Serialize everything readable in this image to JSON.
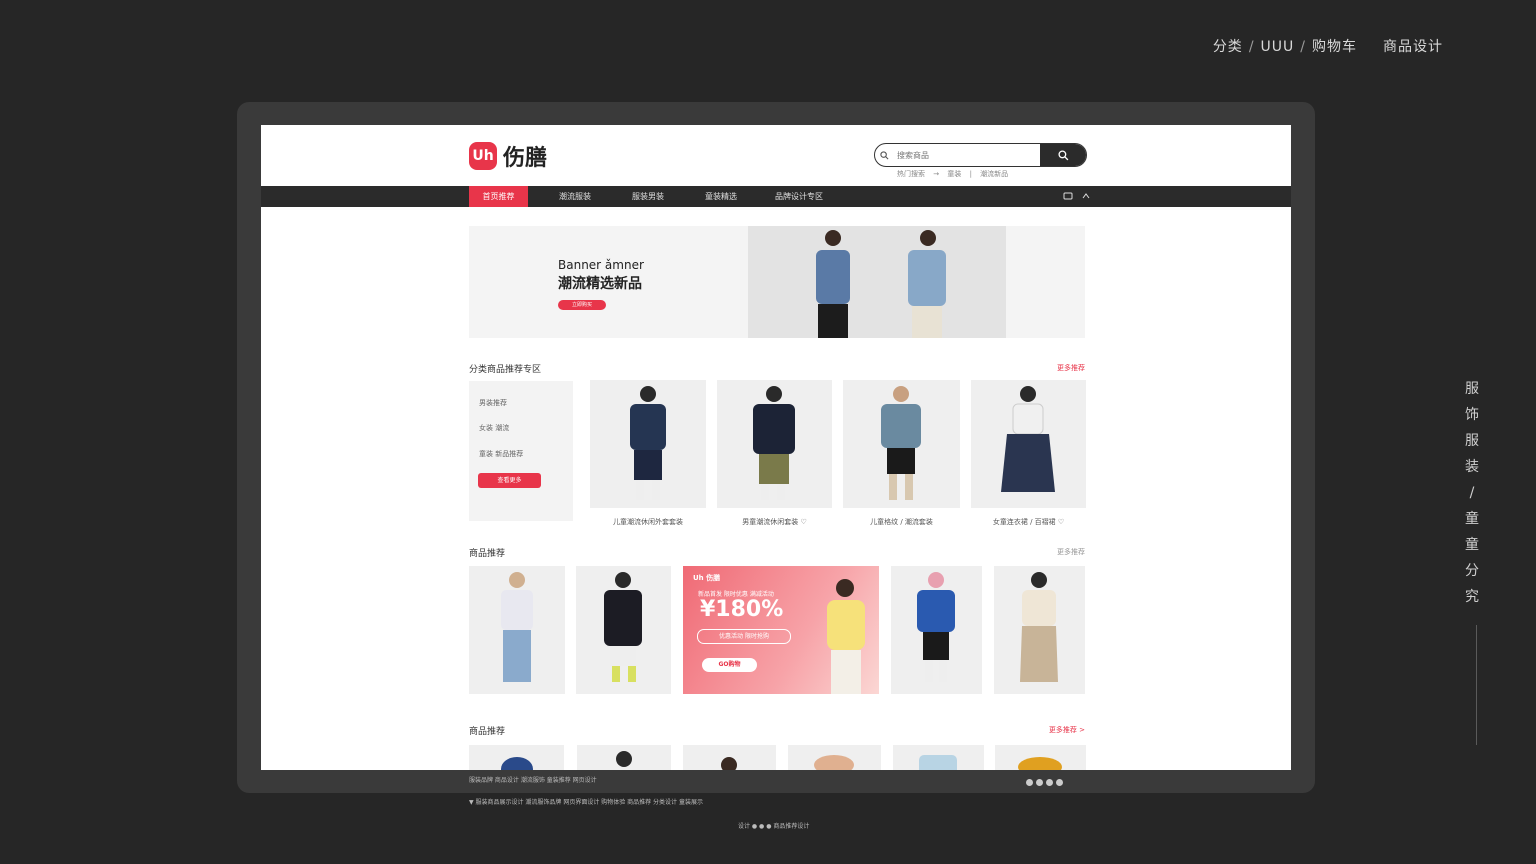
{
  "breadcrumb": {
    "items": [
      "分类",
      "UUU",
      "购物车"
    ],
    "separator": "/",
    "current": "商品设计"
  },
  "side_label": {
    "chars": [
      "服",
      "饰",
      "服",
      "装",
      "/",
      "童",
      "童",
      "分",
      "究"
    ]
  },
  "brand": {
    "logo_mark": "Uh",
    "name": "伤膳",
    "accent": "#e8354a"
  },
  "search": {
    "placeholder": "搜索商品",
    "hot": [
      "热门搜索",
      "→",
      "童装",
      "|",
      "潮流新品"
    ]
  },
  "nav": {
    "items": [
      {
        "label": "首页推荐",
        "active": true
      },
      {
        "label": "潮流服装",
        "active": false
      },
      {
        "label": "服装男装",
        "active": false
      },
      {
        "label": "童装精选",
        "active": false
      },
      {
        "label": "品牌设计专区",
        "active": false
      }
    ],
    "icons": [
      "cart-icon",
      "user-icon"
    ]
  },
  "banner": {
    "title_en": "Banner ǎmner",
    "title_cn": "潮流精选新品",
    "button": "立即购买"
  },
  "section1": {
    "title": "分类商品推荐专区",
    "more": "更多推荐",
    "categories": [
      "男装推荐",
      "女装 潮流",
      "童装 新品推荐"
    ],
    "cat_button": "查看更多",
    "products": [
      {
        "caption": "儿童潮流休闲外套套装"
      },
      {
        "caption": "男童潮流休闲套装 ♡"
      },
      {
        "caption": "儿童格纹 / 潮流套装"
      },
      {
        "caption": "女童连衣裙 / 百褶裙 ♡"
      }
    ]
  },
  "section2": {
    "title": "商品推荐",
    "more": "更多推荐",
    "promo": {
      "brand": "Uh 伤膳",
      "subtitle": "新品首发 限时优惠 满减活动",
      "price": "¥180%",
      "tag": "优惠活动 限时抢购",
      "button": "GO购物"
    }
  },
  "section3": {
    "title": "商品推荐",
    "more": "更多推荐 >"
  },
  "footer": {
    "line1": "服装品牌 商品设计 潮流服饰 童装推荐 网页设计",
    "line2": "▼ 服装商品展示设计 潮流服饰品牌 网页界面设计 购物体验 商品推荐 分类设计 童装展示",
    "line3": "设计 ● ● ● 商品推荐设计"
  }
}
